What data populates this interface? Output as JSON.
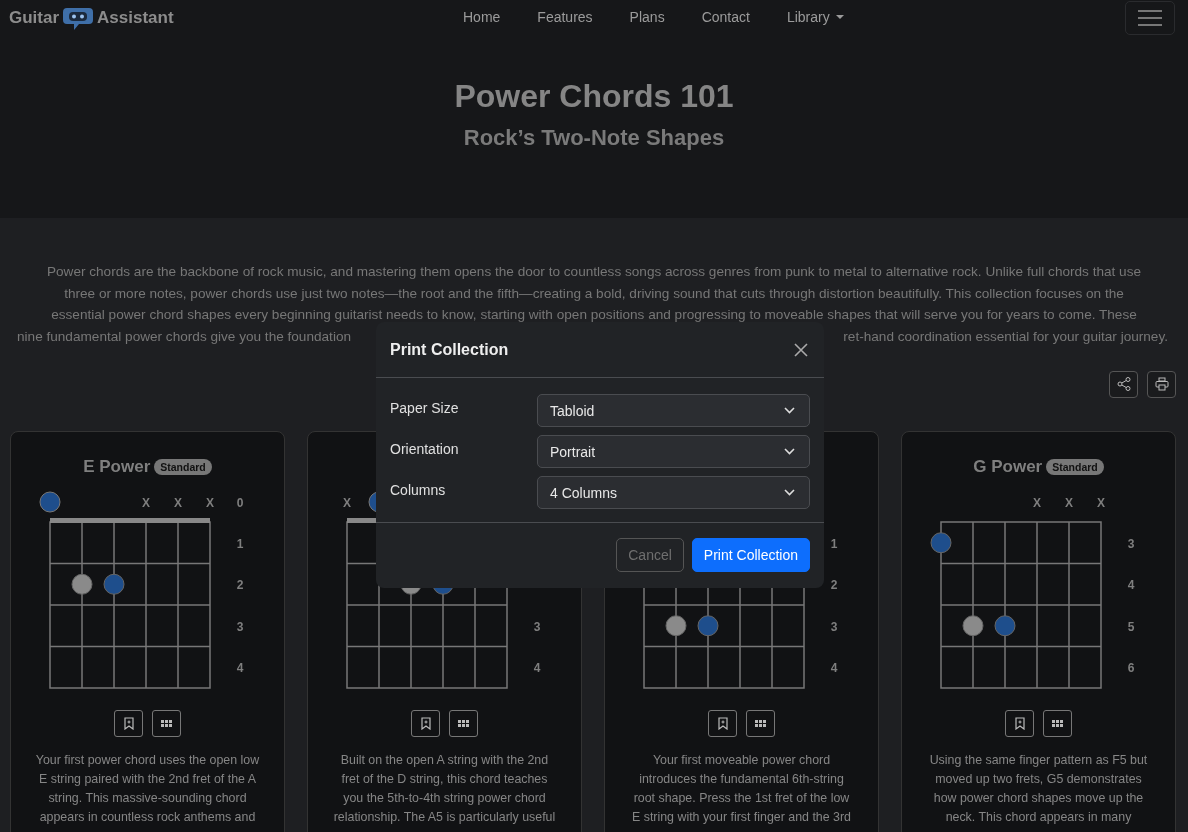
{
  "navbar": {
    "brand": {
      "left": "Guitar",
      "right": "Assistant"
    },
    "links": [
      {
        "label": "Home",
        "dropdown": false
      },
      {
        "label": "Features",
        "dropdown": false
      },
      {
        "label": "Plans",
        "dropdown": false
      },
      {
        "label": "Contact",
        "dropdown": false
      },
      {
        "label": "Library",
        "dropdown": true
      }
    ]
  },
  "hero": {
    "title": "Power Chords 101",
    "subtitle": "Rock’s Two-Note Shapes"
  },
  "intro": {
    "lines": [
      "Power chords are the backbone of rock music, and mastering them opens the door to countless songs across genres from punk to metal to alternative rock. Unlike full chords that use",
      "three or more notes, power chords use just two notes—the root and the fifth—creating a bold, driving sound that cuts through distortion beautifully. This collection focuses on the",
      "essential power chord shapes every beginning guitarist needs to know, starting with open positions and progressing to moveable shapes that will serve you for years to come. These"
    ],
    "last_line_fragments": [
      "nine fundamental power chords give you the foundation",
      "ret-hand coordination essential for your guitar journey."
    ]
  },
  "cards": [
    {
      "title": "E Power",
      "badge": "Standard",
      "nut": true,
      "top": {
        "label": "0",
        "cells": [
          {
            "kind": "root"
          },
          {
            "kind": "blank"
          },
          {
            "kind": "blank"
          },
          {
            "kind": "mute",
            "text": "X"
          },
          {
            "kind": "mute",
            "text": "X"
          },
          {
            "kind": "mute",
            "text": "X"
          }
        ]
      },
      "frets": [
        {
          "label": "1",
          "cells": [
            {
              "kind": "blank"
            },
            {
              "kind": "blank"
            },
            {
              "kind": "blank"
            },
            {
              "kind": "blank"
            },
            {
              "kind": "blank"
            },
            {
              "kind": "blank"
            }
          ]
        },
        {
          "label": "2",
          "cells": [
            {
              "kind": "blank"
            },
            {
              "kind": "note"
            },
            {
              "kind": "root"
            },
            {
              "kind": "blank"
            },
            {
              "kind": "blank"
            },
            {
              "kind": "blank"
            }
          ]
        },
        {
          "label": "3",
          "cells": [
            {
              "kind": "blank"
            },
            {
              "kind": "blank"
            },
            {
              "kind": "blank"
            },
            {
              "kind": "blank"
            },
            {
              "kind": "blank"
            },
            {
              "kind": "blank"
            }
          ]
        },
        {
          "label": "4",
          "cells": [
            {
              "kind": "blank"
            },
            {
              "kind": "blank"
            },
            {
              "kind": "blank"
            },
            {
              "kind": "blank"
            },
            {
              "kind": "blank"
            },
            {
              "kind": "blank"
            }
          ]
        }
      ],
      "description": [
        "Your first power chord uses the open low",
        "E string paired with the 2nd fret of the A",
        "string. This massive-sounding chord",
        "appears in countless rock anthems and"
      ]
    },
    {
      "nut": true,
      "top": {
        "cells": [
          {
            "kind": "mute",
            "text": "X"
          },
          {
            "kind": "root"
          },
          {
            "kind": "blank"
          },
          {
            "kind": "blank"
          },
          {
            "kind": "blank"
          },
          {
            "kind": "blank"
          }
        ]
      },
      "frets": [
        {
          "cells": [
            {
              "kind": "blank"
            },
            {
              "kind": "blank"
            },
            {
              "kind": "blank"
            },
            {
              "kind": "blank"
            },
            {
              "kind": "blank"
            },
            {
              "kind": "blank"
            }
          ]
        },
        {
          "cells": [
            {
              "kind": "blank"
            },
            {
              "kind": "blank"
            },
            {
              "kind": "note"
            },
            {
              "kind": "root"
            },
            {
              "kind": "blank"
            },
            {
              "kind": "blank"
            }
          ]
        },
        {
          "label": "3",
          "cells": [
            {
              "kind": "blank"
            },
            {
              "kind": "blank"
            },
            {
              "kind": "blank"
            },
            {
              "kind": "blank"
            },
            {
              "kind": "blank"
            },
            {
              "kind": "blank"
            }
          ]
        },
        {
          "label": "4",
          "cells": [
            {
              "kind": "blank"
            },
            {
              "kind": "blank"
            },
            {
              "kind": "blank"
            },
            {
              "kind": "blank"
            },
            {
              "kind": "blank"
            },
            {
              "kind": "blank"
            }
          ]
        }
      ],
      "description": [
        "Built on the open A string with the 2nd",
        "fret of the D string, this chord teaches",
        "you the 5th-to-4th string power chord",
        "relationship. The A5 is particularly useful"
      ]
    },
    {
      "top": {
        "cells": [
          {
            "kind": "blank"
          },
          {
            "kind": "blank"
          },
          {
            "kind": "blank"
          },
          {
            "kind": "blank"
          },
          {
            "kind": "blank"
          },
          {
            "kind": "blank"
          }
        ]
      },
      "frets": [
        {
          "label": "1",
          "cells": [
            {
              "kind": "blank"
            },
            {
              "kind": "blank"
            },
            {
              "kind": "blank"
            },
            {
              "kind": "blank"
            },
            {
              "kind": "blank"
            },
            {
              "kind": "blank"
            }
          ]
        },
        {
          "label": "2",
          "cells": [
            {
              "kind": "blank"
            },
            {
              "kind": "blank"
            },
            {
              "kind": "blank"
            },
            {
              "kind": "blank"
            },
            {
              "kind": "blank"
            },
            {
              "kind": "blank"
            }
          ]
        },
        {
          "label": "3",
          "cells": [
            {
              "kind": "blank"
            },
            {
              "kind": "note"
            },
            {
              "kind": "root"
            },
            {
              "kind": "blank"
            },
            {
              "kind": "blank"
            },
            {
              "kind": "blank"
            }
          ]
        },
        {
          "label": "4",
          "cells": [
            {
              "kind": "blank"
            },
            {
              "kind": "blank"
            },
            {
              "kind": "blank"
            },
            {
              "kind": "blank"
            },
            {
              "kind": "blank"
            },
            {
              "kind": "blank"
            }
          ]
        }
      ],
      "description": [
        "Your first moveable power chord",
        "introduces the fundamental 6th-string",
        "root shape. Press the 1st fret of the low",
        "E string with your first finger and the 3rd"
      ]
    },
    {
      "title": "G Power",
      "badge": "Standard",
      "nut": false,
      "top": {
        "cells": [
          {
            "kind": "blank"
          },
          {
            "kind": "blank"
          },
          {
            "kind": "blank"
          },
          {
            "kind": "mute",
            "text": "X"
          },
          {
            "kind": "mute",
            "text": "X"
          },
          {
            "kind": "mute",
            "text": "X"
          }
        ]
      },
      "frets": [
        {
          "label": "3",
          "cells": [
            {
              "kind": "root"
            },
            {
              "kind": "blank"
            },
            {
              "kind": "blank"
            },
            {
              "kind": "blank"
            },
            {
              "kind": "blank"
            },
            {
              "kind": "blank"
            }
          ]
        },
        {
          "label": "4",
          "cells": [
            {
              "kind": "blank"
            },
            {
              "kind": "blank"
            },
            {
              "kind": "blank"
            },
            {
              "kind": "blank"
            },
            {
              "kind": "blank"
            },
            {
              "kind": "blank"
            }
          ]
        },
        {
          "label": "5",
          "cells": [
            {
              "kind": "blank"
            },
            {
              "kind": "note"
            },
            {
              "kind": "root"
            },
            {
              "kind": "blank"
            },
            {
              "kind": "blank"
            },
            {
              "kind": "blank"
            }
          ]
        },
        {
          "label": "6",
          "cells": [
            {
              "kind": "blank"
            },
            {
              "kind": "blank"
            },
            {
              "kind": "blank"
            },
            {
              "kind": "blank"
            },
            {
              "kind": "blank"
            },
            {
              "kind": "blank"
            }
          ]
        }
      ],
      "description": [
        "Using the same finger pattern as F5 but",
        "moved up two frets, G5 demonstrates",
        "how power chord shapes move up the",
        "neck. This chord appears in many"
      ]
    }
  ],
  "modal": {
    "title": "Print Collection",
    "fields": [
      {
        "label": "Paper Size",
        "value": "Tabloid"
      },
      {
        "label": "Orientation",
        "value": "Portrait"
      },
      {
        "label": "Columns",
        "value": "4 Columns"
      }
    ],
    "buttons": [
      {
        "label": "Cancel",
        "kind": "secondary"
      },
      {
        "label": "Print Collection",
        "kind": "primary"
      }
    ]
  }
}
